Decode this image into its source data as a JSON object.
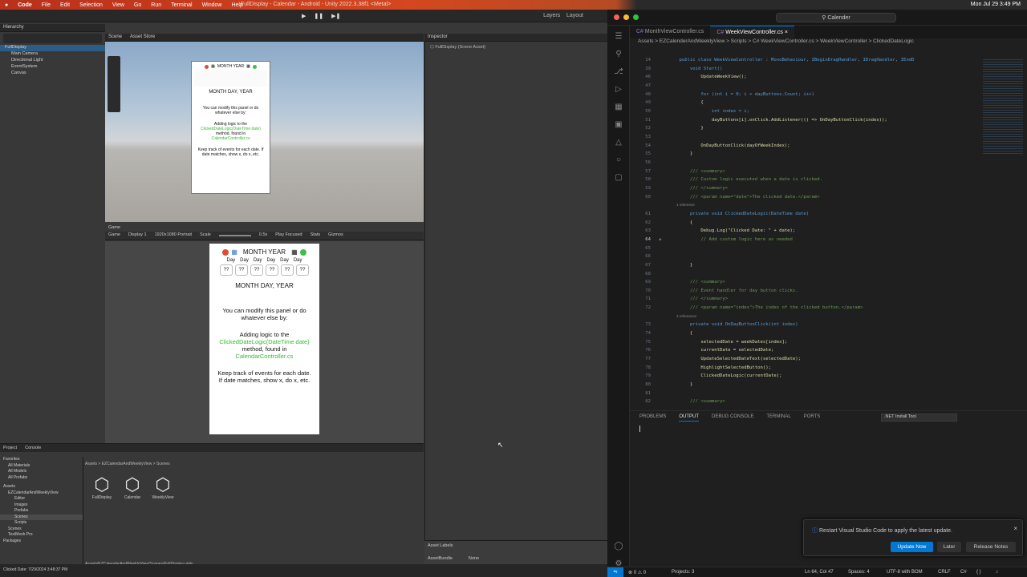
{
  "menubar": {
    "apple": "",
    "app": "Code",
    "items": [
      "File",
      "Edit",
      "Selection",
      "View",
      "Go",
      "Run",
      "Terminal",
      "Window",
      "Help"
    ],
    "unity_title": "FullDisplay - Calendar - Android - Unity 2022.3.38f1 <Metal>",
    "clock": "Mon Jul 29  3:49 PM"
  },
  "unity": {
    "hierarchy_tab": "Hierarchy",
    "hierarchy": [
      "FullDisplay",
      "Main Camera",
      "Directional Light",
      "EventSystem",
      "Canvas"
    ],
    "scene_tabs": [
      "Scene",
      "Asset Store"
    ],
    "inspector_tab": "Inspector",
    "inspector_item": "FullDisplay (Scene Asset)",
    "game_tab": "Game",
    "game_toolbar": [
      "Game",
      "Display 1",
      "1920x1080 Portrait",
      "Scale",
      "0.5x",
      "Play Focused",
      "Stats",
      "Gizmos"
    ],
    "layers": "Layers",
    "layout": "Layout",
    "project_tabs": [
      "Project",
      "Console"
    ],
    "project_tree": [
      "Favorites",
      "All Materials",
      "All Models",
      "All Prefabs",
      "Assets",
      "EZCalendarAndWeeklyView",
      "Editor",
      "Images",
      "Prefabs",
      "Scenes",
      "Scripts",
      "Scenes",
      "TextMesh Pro",
      "Packages"
    ],
    "project_breadcrumb": "Assets > EZCalendarAndWeeklyView > Scenes",
    "assets": [
      "FullDisplay",
      "Calendar",
      "WeeklyView"
    ],
    "asset_labels": "Asset Labels",
    "asset_bundle_label": "AssetBundle",
    "asset_bundle_value": "None",
    "path": "Assets/EZCalendarAndWeeklyView/Scenes/FullDisplay.unity",
    "status": "Clicked Date: 7/29/2024 3:48:37 PM"
  },
  "calendar": {
    "title": "MONTH YEAR",
    "days": [
      "Day",
      "Day",
      "Day",
      "Day",
      "Day",
      "Day"
    ],
    "cells": [
      "??",
      "??",
      "??",
      "??",
      "??",
      "??"
    ],
    "date_label": "MONTH DAY, YEAR",
    "p1": "You can modify this panel or do whatever else by:",
    "p2a": "Adding logic to the",
    "p2b": "ClickedDateLogic(DateTime date)",
    "p2c": "method, found in",
    "p2d": "CalendarController.cs",
    "p3": "Keep track of events for each date. If date matches, show x, do x, etc."
  },
  "vscode": {
    "search": "Calender",
    "tabs": [
      "MonthViewController.cs",
      "WeekViewController.cs"
    ],
    "breadcrumb": "Assets > EZCalenderAndWeeklyView > Scripts > C# WeekViewController.cs > WeekViewController > ClickedDateLogic",
    "lines": [
      {
        "n": "14",
        "t": "    public class WeekViewController : MonoBehaviour, IBeginDragHandler, IDragHandler, IEndD"
      },
      {
        "n": "39",
        "t": "        void Start()"
      },
      {
        "n": "46",
        "t": "            UpdateWeekView();"
      },
      {
        "n": "47",
        "t": ""
      },
      {
        "n": "48",
        "t": "            for (int i = 0; i < dayButtons.Count; i++)"
      },
      {
        "n": "49",
        "t": "            {"
      },
      {
        "n": "50",
        "t": "                int index = i;"
      },
      {
        "n": "51",
        "t": "                dayButtons[i].onClick.AddListener(() => OnDayButtonClick(index));"
      },
      {
        "n": "52",
        "t": "            }"
      },
      {
        "n": "53",
        "t": ""
      },
      {
        "n": "54",
        "t": "            OnDayButtonClick(dayOfWeekIndex);"
      },
      {
        "n": "55",
        "t": "        }"
      },
      {
        "n": "56",
        "t": ""
      },
      {
        "n": "57",
        "t": "        /// <summary>"
      },
      {
        "n": "58",
        "t": "        /// Custom logic executed when a date is clicked."
      },
      {
        "n": "59",
        "t": "        /// </summary>"
      },
      {
        "n": "60",
        "t": "        /// <param name=\"date\">The clicked date.</param>"
      },
      {
        "n": "",
        "t": "        1 reference"
      },
      {
        "n": "61",
        "t": "        private void ClickedDateLogic(DateTime date)"
      },
      {
        "n": "62",
        "t": "        {"
      },
      {
        "n": "63",
        "t": "            Debug.Log(\"Clicked Date: \" + date);"
      },
      {
        "n": "64",
        "t": "            // Add custom logic here as needed"
      },
      {
        "n": "65",
        "t": ""
      },
      {
        "n": "66",
        "t": ""
      },
      {
        "n": "67",
        "t": "        }"
      },
      {
        "n": "68",
        "t": ""
      },
      {
        "n": "69",
        "t": "        /// <summary>"
      },
      {
        "n": "70",
        "t": "        /// Event handler for day button clicks."
      },
      {
        "n": "71",
        "t": "        /// </summary>"
      },
      {
        "n": "72",
        "t": "        /// <param name=\"index\">The index of the clicked button.</param>"
      },
      {
        "n": "",
        "t": "        3 references"
      },
      {
        "n": "73",
        "t": "        private void OnDayButtonClick(int index)"
      },
      {
        "n": "74",
        "t": "        {"
      },
      {
        "n": "75",
        "t": "            selectedDate = weekDates[index];"
      },
      {
        "n": "76",
        "t": "            currentDate = selectedDate;"
      },
      {
        "n": "77",
        "t": "            UpdateSelectedDateText(selectedDate);"
      },
      {
        "n": "78",
        "t": "            HighlightSelectedButton();"
      },
      {
        "n": "79",
        "t": "            ClickedDateLogic(currentDate);"
      },
      {
        "n": "80",
        "t": "        }"
      },
      {
        "n": "81",
        "t": ""
      },
      {
        "n": "82",
        "t": "        /// <summary>"
      }
    ],
    "panel_tabs": [
      "PROBLEMS",
      "OUTPUT",
      "DEBUG CONSOLE",
      "TERMINAL",
      "PORTS"
    ],
    "output_select": ".NET Install Tool",
    "notification": {
      "msg": "Restart Visual Studio Code to apply the latest update.",
      "update": "Update Now",
      "later": "Later",
      "notes": "Release Notes"
    },
    "status": {
      "errors": "0",
      "warnings": "0",
      "projects": "Projects: 3",
      "pos": "Ln 64, Col 47",
      "spaces": "Spaces: 4",
      "enc": "UTF-8 with BOM",
      "eol": "CRLF",
      "lang": "C#"
    }
  }
}
